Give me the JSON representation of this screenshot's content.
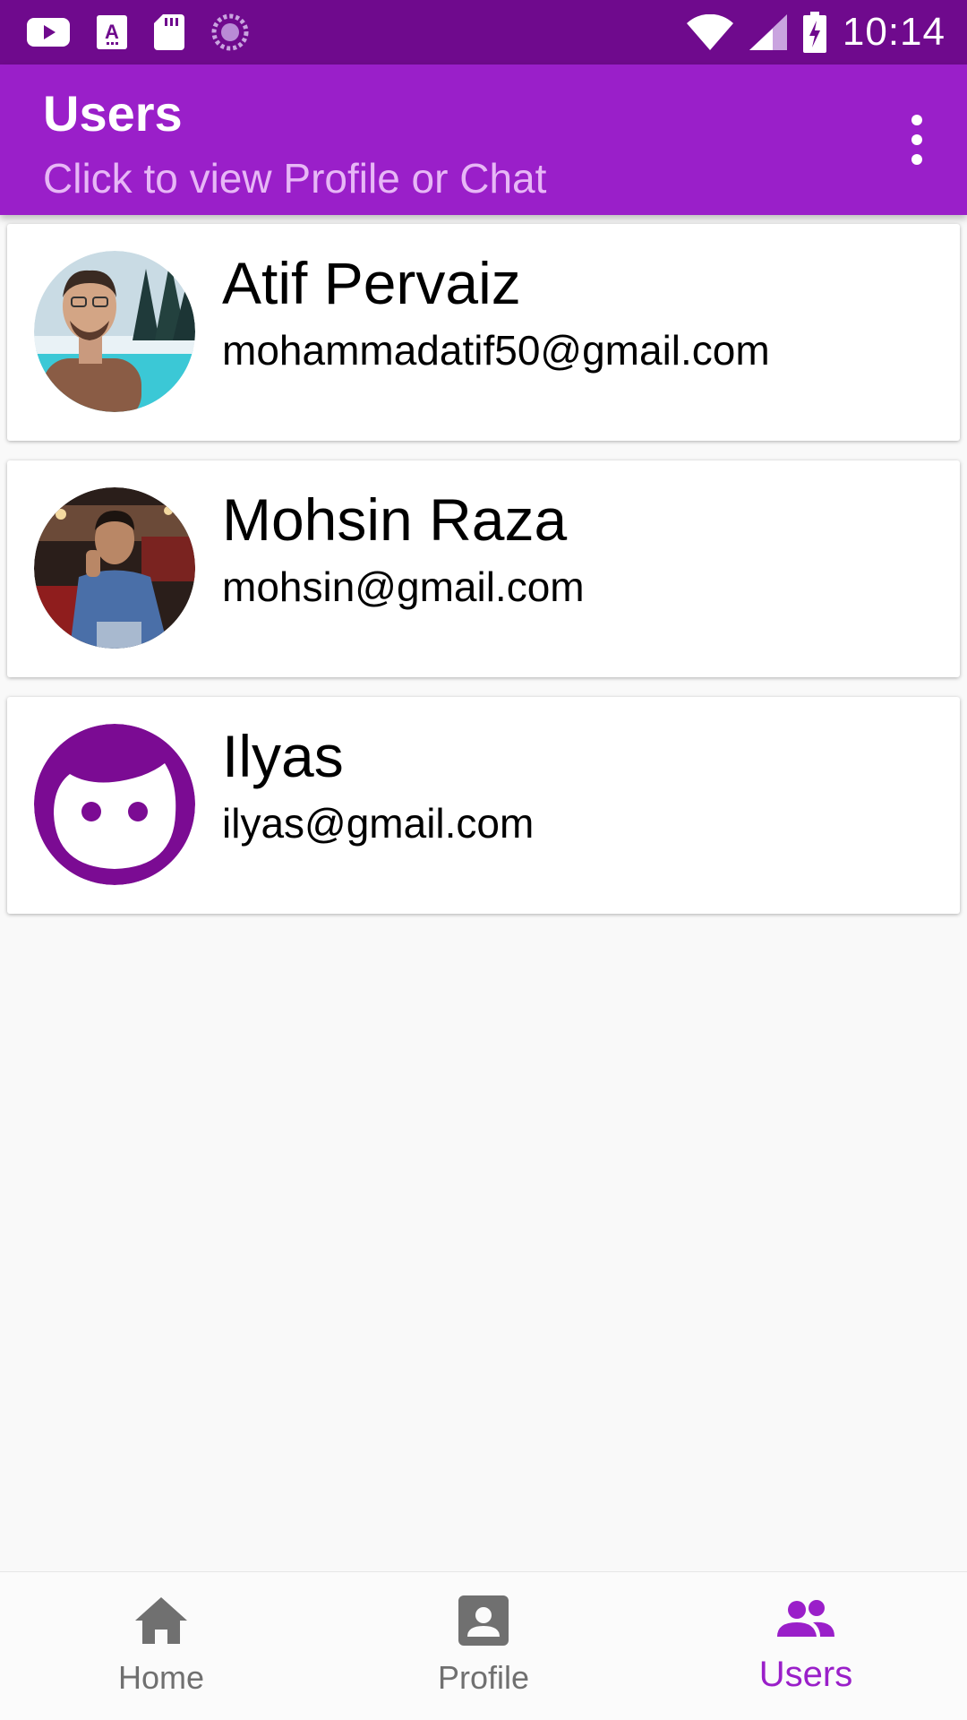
{
  "status_bar": {
    "time": "10:14",
    "icons": [
      "youtube-icon",
      "font-download-icon",
      "sd-card-icon",
      "sync-icon",
      "wifi-icon",
      "signal-icon",
      "battery-charging-icon"
    ]
  },
  "app_bar": {
    "title": "Users",
    "subtitle": "Click to view Profile or Chat",
    "menu_icon": "more-vert-icon"
  },
  "users": [
    {
      "name": "Atif Pervaiz",
      "email": "mohammadatif50@gmail.com",
      "avatar": "photo"
    },
    {
      "name": "Mohsin Raza",
      "email": "mohsin@gmail.com",
      "avatar": "photo"
    },
    {
      "name": "Ilyas",
      "email": "ilyas@gmail.com",
      "avatar": "default-face-icon"
    }
  ],
  "bottom_nav": {
    "items": [
      {
        "label": "Home",
        "icon": "home-icon",
        "active": false
      },
      {
        "label": "Profile",
        "icon": "account-box-icon",
        "active": false
      },
      {
        "label": "Users",
        "icon": "people-icon",
        "active": true
      }
    ]
  },
  "colors": {
    "status_bar": "#6f0a8d",
    "app_bar": "#9a1fc9",
    "accent": "#9a1fc9",
    "inactive": "#707070"
  }
}
